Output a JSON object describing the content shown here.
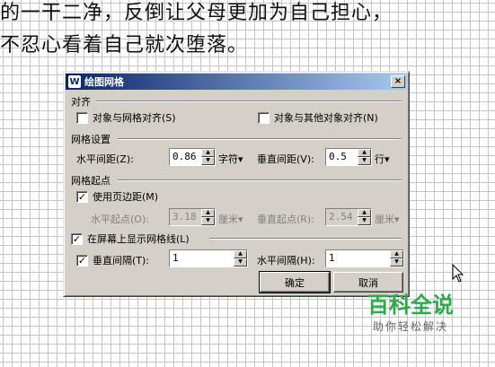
{
  "document": {
    "line1": "的一干二净，反倒让父母更加为自己担心，",
    "line2": "不忍心看着自己就次堕落。"
  },
  "dialog": {
    "title": "绘图网格",
    "close_label": "×",
    "align_section": "对齐",
    "snap_to_grid": {
      "label": "对象与网格对齐(S)",
      "checked": false
    },
    "snap_to_objects": {
      "label": "对象与其他对象对齐(N)",
      "checked": false
    },
    "grid_settings_section": "网格设置",
    "horizontal_spacing": {
      "label": "水平间距(Z):",
      "value": "0.86",
      "unit": "字符▾"
    },
    "vertical_spacing": {
      "label": "垂直间距(V):",
      "value": "0.5",
      "unit": "行▾"
    },
    "grid_origin_section": "网格起点",
    "use_margins": {
      "label": "使用页边距(M)",
      "checked": true
    },
    "horizontal_origin": {
      "label": "水平起点(O):",
      "value": "3.18",
      "unit": "厘米▾"
    },
    "vertical_origin": {
      "label": "垂直起点(R):",
      "value": "2.54",
      "unit": "厘米▾"
    },
    "display_gridlines": {
      "label": "在屏幕上显示网格线(L)",
      "checked": true
    },
    "vertical_every": {
      "label": "垂直间隔(T):",
      "value": "1",
      "checked": true
    },
    "horizontal_every": {
      "label": "水平间隔(H):",
      "value": "1"
    },
    "ok_label": "确定",
    "cancel_label": "取消"
  },
  "watermark": {
    "title": "百科全说",
    "subtitle": "助你轻松解决"
  },
  "colors": {
    "dialog_bg": "#d4d0c8",
    "titlebar_start": "#0a246a",
    "watermark_green": "#2fa84a"
  }
}
